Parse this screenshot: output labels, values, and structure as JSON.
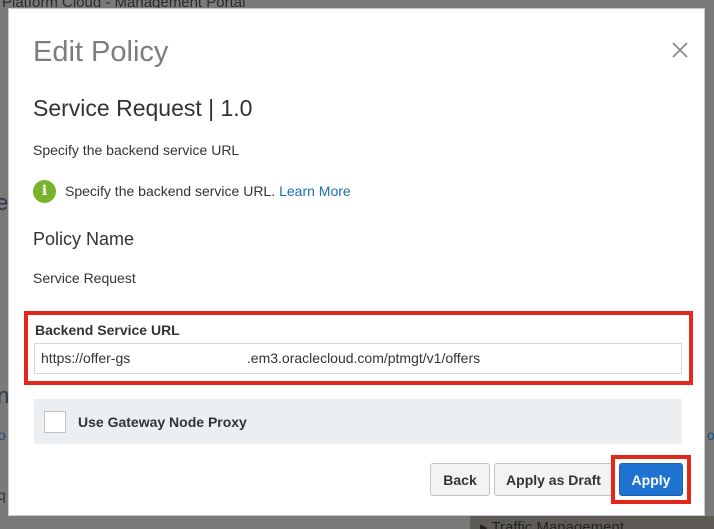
{
  "background": {
    "page_title": "Platform Cloud - Management Portal",
    "fragments": [
      "e",
      "n",
      "o",
      "o",
      "q"
    ],
    "bottom_text": "Traffic Management"
  },
  "modal": {
    "title": "Edit Policy",
    "close_icon": "close-icon",
    "service_title": "Service Request | 1.0",
    "description": "Specify the backend service URL",
    "info": {
      "icon": "info-icon",
      "icon_glyph": "i",
      "text": "Specify the backend service URL.",
      "link_text": "Learn More"
    },
    "policy_name": {
      "label": "Policy Name",
      "value": "Service Request"
    },
    "backend_url": {
      "label": "Backend Service URL",
      "value": "https://offer-gs                              .em3.oraclecloud.com/ptmgt/v1/offers"
    },
    "gateway_proxy": {
      "label": "Use Gateway Node Proxy",
      "checked": false
    },
    "buttons": {
      "back": "Back",
      "apply_draft": "Apply as Draft",
      "apply": "Apply"
    }
  },
  "colors": {
    "accent": "#1e73d1",
    "link": "#1a6fb5",
    "info_icon": "#79b32c",
    "highlight": "#e3271b"
  }
}
